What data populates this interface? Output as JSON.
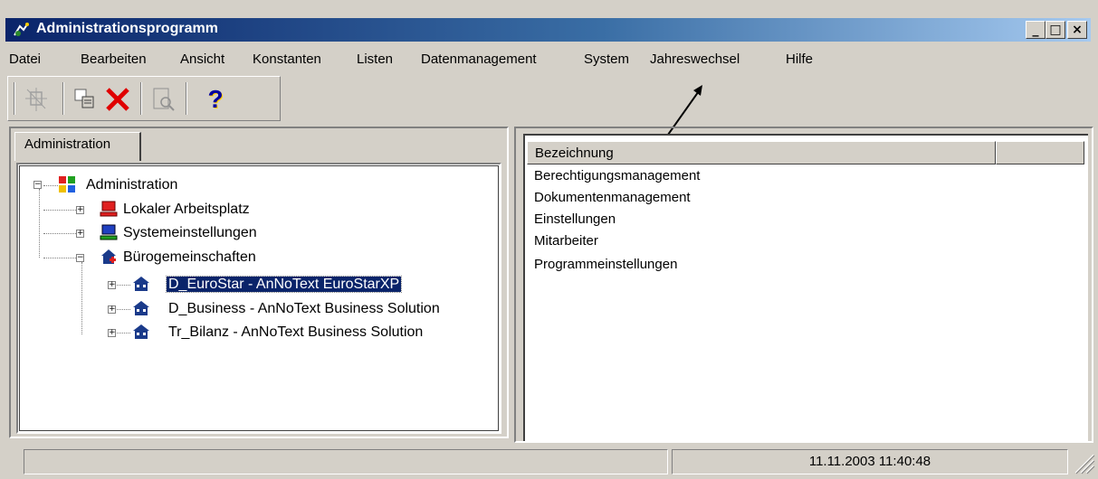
{
  "window": {
    "title": "Administrationsprogramm",
    "buttons": {
      "minimize": "_",
      "maximize": "□",
      "close": "×"
    }
  },
  "menu": [
    "Datei",
    "Bearbeiten",
    "Ansicht",
    "Konstanten",
    "Listen",
    "Datenmanagement",
    "System",
    "Jahreswechsel",
    "Hilfe"
  ],
  "toolbar": {
    "buttons": [
      {
        "icon": "new-item-icon",
        "enabled": false
      },
      {
        "icon": "copy-icon",
        "enabled": true
      },
      {
        "icon": "delete-icon",
        "enabled": true
      },
      {
        "icon": "print-preview-icon",
        "enabled": false
      },
      {
        "icon": "help-icon",
        "label": "?",
        "enabled": true
      }
    ]
  },
  "left": {
    "tab": "Administration",
    "tree": {
      "root": "Administration",
      "children": [
        {
          "label": "Lokaler Arbeitsplatz",
          "icon": "computer-red-icon"
        },
        {
          "label": "Systemeinstellungen",
          "icon": "computer-blue-icon"
        },
        {
          "label": "Bürogemeinschaften",
          "icon": "office-group-icon",
          "children": [
            {
              "label": "D_EuroStar - AnNoText EuroStarXP",
              "selected": true
            },
            {
              "label": "D_Business - AnNoText Business Solution"
            },
            {
              "label": "Tr_Bilanz - AnNoText Business Solution"
            }
          ]
        }
      ]
    }
  },
  "right": {
    "columns": [
      "Bezeichnung",
      ""
    ],
    "items": [
      "Berechtigungsmanagement",
      "Dokumentenmanagement",
      "Einstellungen",
      "Mitarbeiter",
      "Programmeinstellungen"
    ]
  },
  "status": {
    "left": "",
    "datetime": "11.11.2003 11:40:48"
  },
  "colors": {
    "title_start": "#0a246a",
    "title_end": "#a6caf0",
    "face": "#d4d0c8",
    "selection": "#0a246a"
  }
}
